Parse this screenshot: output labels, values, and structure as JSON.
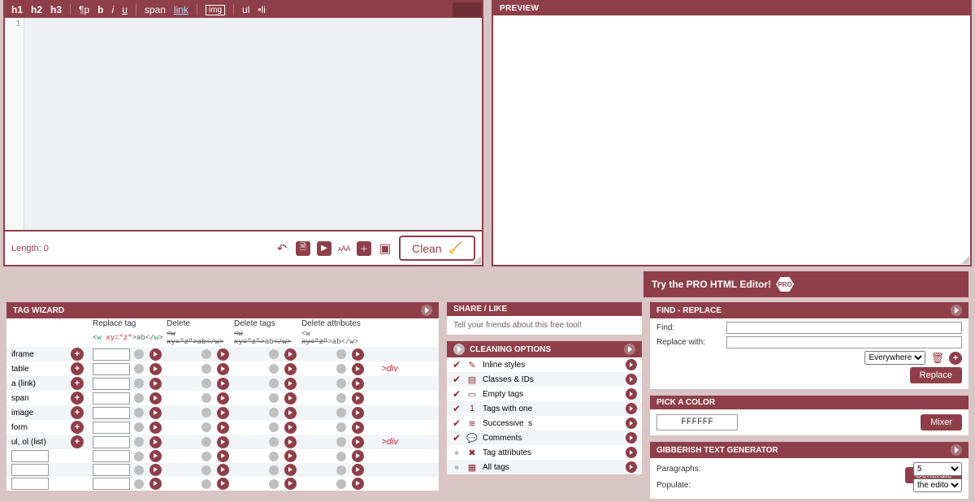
{
  "editor": {
    "toolbar": {
      "h1": "h1",
      "h2": "h2",
      "h3": "h3",
      "p": "¶p",
      "b": "b",
      "i": "i",
      "u": "u",
      "span": "span",
      "link": "link",
      "img": "img",
      "ul": "ul",
      "li": "•li"
    },
    "gutter_line": "1",
    "length_label": "Length: 0",
    "clean_label": "Clean"
  },
  "preview": {
    "title": "PREVIEW"
  },
  "pro_banner": {
    "text": "Try the PRO HTML Editor!",
    "badge": "PRO"
  },
  "tag_wizard": {
    "title": "TAG WIZARD",
    "headers": {
      "replace": "Replace tag",
      "delete": "Delete",
      "delete_tags": "Delete tags",
      "delete_attr": "Delete attributes"
    },
    "sub": {
      "replace": "<w xy=\"z\">ab</w>",
      "delete": "<w xy=\"z\">ab</w>",
      "delete_tags": "<w xy=\"z\">ab</w>",
      "delete_attr": "<w xy=\"z\">ab</w>"
    },
    "rows": [
      {
        "tag": "iframe",
        "note": ""
      },
      {
        "tag": "table",
        "note": ">div"
      },
      {
        "tag": "a (link)",
        "note": ""
      },
      {
        "tag": "span",
        "note": ""
      },
      {
        "tag": "image",
        "note": ""
      },
      {
        "tag": "form",
        "note": ""
      },
      {
        "tag": "ul, ol (list)",
        "note": ">div"
      },
      {
        "tag": "",
        "note": ""
      },
      {
        "tag": "",
        "note": ""
      },
      {
        "tag": "",
        "note": ""
      }
    ]
  },
  "share": {
    "title": "SHARE / LIKE",
    "text": "Tell your friends about this free tool!"
  },
  "cleaning": {
    "title": "CLEANING OPTIONS",
    "items": [
      {
        "on": true,
        "icon": "✎",
        "label": "Inline styles"
      },
      {
        "on": true,
        "icon": "▤",
        "label": "Classes & IDs"
      },
      {
        "on": true,
        "icon": "▭",
        "label": "Empty tags"
      },
      {
        "on": true,
        "icon": "1",
        "label": "Tags with one &nbsp;"
      },
      {
        "on": true,
        "icon": "≋",
        "label": "Successive &nbsp;s"
      },
      {
        "on": true,
        "icon": "💬",
        "label": "Comments"
      },
      {
        "on": false,
        "icon": "✖",
        "label": "Tag attributes"
      },
      {
        "on": false,
        "icon": "▦",
        "label": "All tags"
      }
    ]
  },
  "find_replace": {
    "title": "FIND - REPLACE",
    "find_label": "Find:",
    "replace_label": "Replace with:",
    "scope_options": [
      "Everywhere"
    ],
    "scope_value": "Everywhere",
    "button": "Replace"
  },
  "color": {
    "title": "PICK A COLOR",
    "value": "FFFFFF",
    "button": "Mixer"
  },
  "gibberish": {
    "title": "GIBBERISH TEXT GENERATOR",
    "paragraphs_label": "Paragraphs:",
    "paragraphs_value": "5",
    "populate_label": "Populate:",
    "populate_value": "the editor",
    "button": "Generate"
  }
}
